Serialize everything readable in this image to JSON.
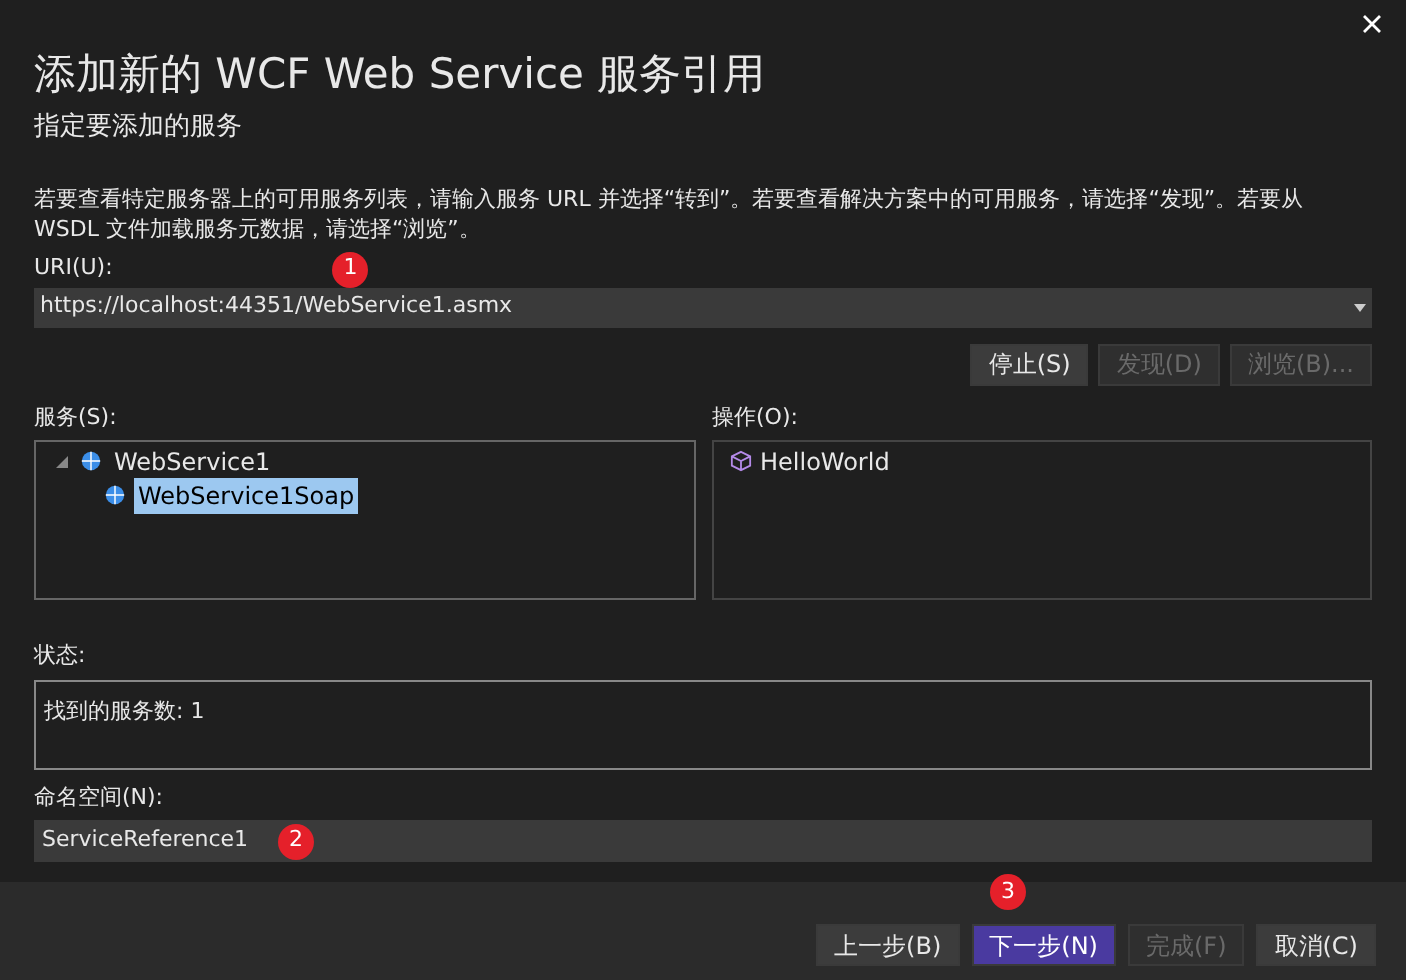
{
  "window": {
    "title": "添加新的 WCF Web Service 服务引用",
    "subtitle": "指定要添加的服务"
  },
  "description": "若要查看特定服务器上的可用服务列表，请输入服务 URL 并选择“转到”。若要查看解决方案中的可用服务，请选择“发现”。若要从 WSDL 文件加载服务元数据，请选择“浏览”。",
  "uri": {
    "label": "URI(U):",
    "value": "https://localhost:44351/WebService1.asmx",
    "badge": "1"
  },
  "uri_buttons": [
    {
      "label": "停止(S)",
      "disabled": false
    },
    {
      "label": "发现(D)",
      "disabled": true
    },
    {
      "label": "浏览(B)...",
      "disabled": true
    }
  ],
  "services": {
    "label": "服务(S):",
    "tree": [
      {
        "label": "WebService1",
        "expanded": true,
        "selected": false,
        "children": [
          {
            "label": "WebService1Soap",
            "selected": true
          }
        ]
      }
    ]
  },
  "operations": {
    "label": "操作(O):",
    "items": [
      "HelloWorld"
    ]
  },
  "status": {
    "label": "状态:",
    "text": "找到的服务数: 1"
  },
  "namespace": {
    "label": "命名空间(N):",
    "value": "ServiceReference1",
    "badge": "2"
  },
  "footer": {
    "badge": "3",
    "buttons": [
      {
        "label": "上一步(B)",
        "disabled": false,
        "primary": false
      },
      {
        "label": "下一步(N)",
        "disabled": false,
        "primary": true
      },
      {
        "label": "完成(F)",
        "disabled": true,
        "primary": false
      },
      {
        "label": "取消(C)",
        "disabled": false,
        "primary": false
      }
    ]
  }
}
